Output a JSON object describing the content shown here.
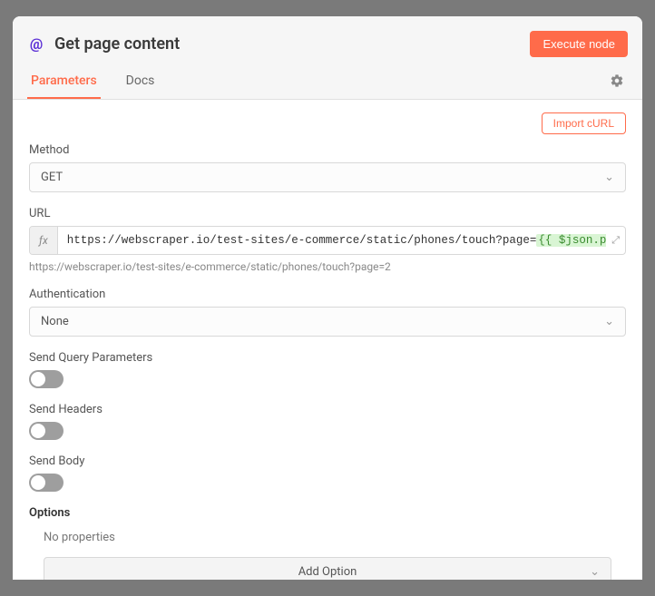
{
  "header": {
    "title": "Get page content",
    "execute": "Execute node"
  },
  "tabs": {
    "parameters": "Parameters",
    "docs": "Docs"
  },
  "actions": {
    "import_curl": "Import cURL"
  },
  "fields": {
    "method": {
      "label": "Method",
      "value": "GET"
    },
    "url": {
      "label": "URL",
      "prefix": "https://webscraper.io/test-sites/e-commerce/static/phones/touch?page=",
      "expr": "{{ $json.page }}",
      "resolved": "https://webscraper.io/test-sites/e-commerce/static/phones/touch?page=2"
    },
    "auth": {
      "label": "Authentication",
      "value": "None"
    },
    "send_query": {
      "label": "Send Query Parameters"
    },
    "send_headers": {
      "label": "Send Headers"
    },
    "send_body": {
      "label": "Send Body"
    }
  },
  "options": {
    "heading": "Options",
    "empty": "No properties",
    "add": "Add Option"
  }
}
